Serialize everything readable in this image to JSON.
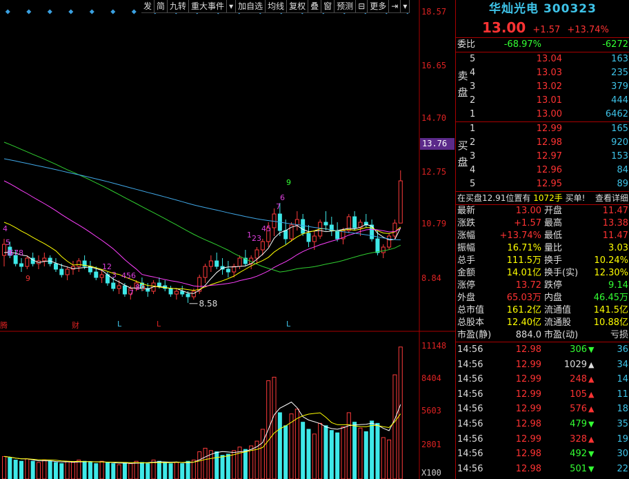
{
  "toolbar": [
    "发",
    "简",
    "九转",
    "重大事件",
    "▾",
    "加自选",
    "均线",
    "复权",
    "叠",
    "窗",
    "预测",
    "⊟",
    "更多",
    "⇥",
    "▾"
  ],
  "price_axis": [
    "18.57",
    "16.65",
    "14.70",
    "13.76",
    "12.75",
    "10.79",
    "8.84"
  ],
  "volume_axis": [
    "11148",
    "8404",
    "5603",
    "2801",
    "X100"
  ],
  "current_price_tag": "13.76",
  "low_marker": "8.58",
  "event_labels": [
    {
      "text": "腾",
      "color": "#dd2222"
    },
    {
      "text": "财",
      "color": "#dd2222"
    },
    {
      "text": "L",
      "color": "#3ec3e8"
    },
    {
      "text": "L",
      "color": "#dd2222"
    },
    {
      "text": "L",
      "color": "#3ec3e8"
    }
  ],
  "td_marks": [
    {
      "text": "9",
      "color": "#3f3"
    },
    {
      "text": "7",
      "color": "#e040e0"
    },
    {
      "text": "6",
      "color": "#e040e0"
    },
    {
      "text": "45",
      "color": "#e040e0"
    },
    {
      "text": "23",
      "color": "#e040e0"
    },
    {
      "text": "1",
      "color": "#e040e0"
    },
    {
      "text": "5",
      "color": "#e040e0"
    },
    {
      "text": "4",
      "color": "#e040e0"
    },
    {
      "text": "678",
      "color": "#e040e0"
    },
    {
      "text": "9",
      "color": "#e33"
    },
    {
      "text": "12",
      "color": "#e040e0"
    },
    {
      "text": "3",
      "color": "#e040e0"
    },
    {
      "text": "456",
      "color": "#e040e0"
    },
    {
      "text": "8",
      "color": "#e040e0"
    },
    {
      "text": "9",
      "color": "#e33"
    },
    {
      "text": "7",
      "color": "#e040e0"
    },
    {
      "text": "8",
      "color": "#e040e0"
    }
  ],
  "stock": {
    "name": "华灿光电",
    "code": "300323",
    "price": "13.00",
    "change": "+1.57",
    "change_pct": "+13.74%"
  },
  "weibi": {
    "label": "委比",
    "pct": "-68.97%",
    "diff": "-6272"
  },
  "sell": {
    "side": [
      "卖",
      "盘"
    ],
    "levels": [
      {
        "lvl": "5",
        "price": "13.04",
        "vol": "163"
      },
      {
        "lvl": "4",
        "price": "13.03",
        "vol": "235"
      },
      {
        "lvl": "3",
        "price": "13.02",
        "vol": "379"
      },
      {
        "lvl": "2",
        "price": "13.01",
        "vol": "444"
      },
      {
        "lvl": "1",
        "price": "13.00",
        "vol": "6462"
      }
    ]
  },
  "buy": {
    "side": [
      "买",
      "盘"
    ],
    "levels": [
      {
        "lvl": "1",
        "price": "12.99",
        "vol": "165"
      },
      {
        "lvl": "2",
        "price": "12.98",
        "vol": "920"
      },
      {
        "lvl": "3",
        "price": "12.97",
        "vol": "153"
      },
      {
        "lvl": "4",
        "price": "12.96",
        "vol": "84"
      },
      {
        "lvl": "5",
        "price": "12.95",
        "vol": "89"
      }
    ]
  },
  "info_line": {
    "a": "在买盘",
    "b": "12.91",
    "c": "位置有",
    "d": "1072手",
    "e": "买单!",
    "link": "查看详细"
  },
  "stats": [
    {
      "l1": "最新",
      "v1": "13.00",
      "c1": "red",
      "l2": "开盘",
      "v2": "11.47",
      "c2": "red"
    },
    {
      "l1": "涨跌",
      "v1": "+1.57",
      "c1": "red",
      "l2": "最高",
      "v2": "13.38",
      "c2": "red"
    },
    {
      "l1": "涨幅",
      "v1": "+13.74%",
      "c1": "red",
      "l2": "最低",
      "v2": "11.47",
      "c2": "red"
    },
    {
      "l1": "振幅",
      "v1": "16.71%",
      "c1": "yellow",
      "l2": "量比",
      "v2": "3.03",
      "c2": "yellow"
    },
    {
      "l1": "总手",
      "v1": "111.5万",
      "c1": "yellow",
      "l2": "换手",
      "v2": "10.24%",
      "c2": "yellow"
    },
    {
      "l1": "金额",
      "v1": "14.01亿",
      "c1": "yellow",
      "l2": "换手(实)",
      "v2": "12.30%",
      "c2": "yellow"
    },
    {
      "l1": "涨停",
      "v1": "13.72",
      "c1": "red",
      "l2": "跌停",
      "v2": "9.14",
      "c2": "green"
    },
    {
      "l1": "外盘",
      "v1": "65.03万",
      "c1": "red",
      "l2": "内盘",
      "v2": "46.45万",
      "c2": "green"
    },
    {
      "l1": "总市值",
      "v1": "161.2亿",
      "c1": "yellow",
      "l2": "流通值",
      "v2": "141.5亿",
      "c2": "yellow"
    },
    {
      "l1": "总股本",
      "v1": "12.40亿",
      "c1": "yellow",
      "l2": "流通股",
      "v2": "10.88亿",
      "c2": "yellow"
    },
    {
      "l1": "市盈(静)",
      "v1": "884.0",
      "c1": "white",
      "l2": "市盈(动)",
      "v2": "亏损",
      "c2": "white"
    }
  ],
  "ticks": [
    {
      "t": "14:56",
      "p": "12.98",
      "v": "306",
      "dir": "down",
      "n": "36"
    },
    {
      "t": "14:56",
      "p": "12.99",
      "v": "1029",
      "dir": "up-white",
      "n": "34"
    },
    {
      "t": "14:56",
      "p": "12.99",
      "v": "248",
      "dir": "up",
      "n": "14"
    },
    {
      "t": "14:56",
      "p": "12.99",
      "v": "105",
      "dir": "up",
      "n": "11"
    },
    {
      "t": "14:56",
      "p": "12.99",
      "v": "576",
      "dir": "up",
      "n": "18"
    },
    {
      "t": "14:56",
      "p": "12.98",
      "v": "479",
      "dir": "down",
      "n": "35"
    },
    {
      "t": "14:56",
      "p": "12.99",
      "v": "328",
      "dir": "up",
      "n": "19"
    },
    {
      "t": "14:56",
      "p": "12.98",
      "v": "492",
      "dir": "down",
      "n": "30"
    },
    {
      "t": "14:56",
      "p": "12.98",
      "v": "501",
      "dir": "down",
      "n": "22"
    }
  ],
  "chart_data": {
    "type": "candlestick",
    "candles": [
      [
        10.3,
        10.9,
        9.9,
        10.7
      ],
      [
        10.6,
        10.8,
        10.2,
        10.3
      ],
      [
        10.3,
        10.5,
        9.9,
        10.0
      ],
      [
        10.0,
        10.2,
        9.7,
        9.9
      ],
      [
        9.9,
        10.3,
        9.8,
        10.2
      ],
      [
        10.2,
        10.4,
        9.9,
        10.0
      ],
      [
        10.0,
        10.3,
        9.8,
        10.1
      ],
      [
        10.1,
        10.4,
        9.9,
        10.2
      ],
      [
        10.2,
        10.3,
        9.9,
        10.0
      ],
      [
        10.0,
        10.2,
        9.7,
        9.8
      ],
      [
        9.8,
        10.0,
        9.5,
        9.6
      ],
      [
        9.6,
        9.9,
        9.4,
        9.8
      ],
      [
        9.8,
        10.1,
        9.6,
        9.9
      ],
      [
        9.9,
        10.2,
        9.7,
        10.1
      ],
      [
        10.1,
        10.3,
        9.8,
        9.9
      ],
      [
        9.9,
        10.1,
        9.6,
        9.7
      ],
      [
        9.7,
        9.9,
        9.4,
        9.5
      ],
      [
        9.5,
        9.8,
        9.3,
        9.6
      ],
      [
        9.6,
        9.7,
        9.2,
        9.3
      ],
      [
        9.3,
        9.5,
        9.0,
        9.1
      ],
      [
        9.1,
        9.4,
        8.9,
        9.2
      ],
      [
        9.2,
        9.3,
        8.8,
        8.9
      ],
      [
        8.9,
        9.2,
        8.7,
        9.1
      ],
      [
        9.1,
        9.4,
        9.0,
        9.3
      ],
      [
        9.3,
        9.5,
        9.0,
        9.1
      ],
      [
        9.1,
        9.3,
        8.8,
        9.0
      ],
      [
        9.0,
        9.4,
        8.9,
        9.3
      ],
      [
        9.3,
        9.5,
        9.1,
        9.2
      ],
      [
        9.2,
        9.4,
        9.0,
        9.1
      ],
      [
        9.1,
        9.2,
        8.8,
        8.9
      ],
      [
        8.9,
        9.1,
        8.7,
        9.0
      ],
      [
        9.0,
        9.2,
        8.8,
        8.9
      ],
      [
        8.9,
        9.0,
        8.58,
        8.8
      ],
      [
        8.8,
        9.1,
        8.7,
        9.0
      ],
      [
        9.0,
        9.6,
        8.9,
        9.5
      ],
      [
        9.5,
        10.0,
        9.3,
        9.9
      ],
      [
        9.9,
        10.3,
        9.7,
        10.1
      ],
      [
        10.1,
        10.4,
        9.8,
        9.9
      ],
      [
        9.9,
        10.2,
        9.6,
        9.8
      ],
      [
        9.8,
        10.1,
        9.5,
        9.7
      ],
      [
        9.7,
        10.0,
        9.5,
        9.9
      ],
      [
        9.9,
        10.3,
        9.8,
        10.2
      ],
      [
        10.2,
        10.5,
        9.9,
        10.0
      ],
      [
        10.0,
        10.3,
        9.8,
        10.2
      ],
      [
        10.2,
        10.6,
        10.0,
        10.5
      ],
      [
        10.5,
        10.9,
        10.3,
        10.8
      ],
      [
        10.8,
        11.5,
        10.6,
        11.3
      ],
      [
        11.3,
        12.0,
        11.0,
        11.8
      ],
      [
        11.8,
        12.2,
        11.0,
        11.2
      ],
      [
        11.2,
        11.6,
        10.7,
        10.9
      ],
      [
        10.9,
        11.5,
        10.8,
        11.4
      ],
      [
        11.4,
        11.9,
        11.2,
        11.6
      ],
      [
        11.6,
        11.8,
        11.0,
        11.1
      ],
      [
        11.1,
        11.4,
        10.6,
        10.8
      ],
      [
        10.8,
        11.2,
        10.5,
        11.0
      ],
      [
        11.0,
        11.6,
        10.9,
        11.5
      ],
      [
        11.5,
        11.9,
        11.2,
        11.4
      ],
      [
        11.4,
        11.7,
        11.0,
        11.2
      ],
      [
        11.2,
        11.5,
        10.8,
        10.9
      ],
      [
        10.9,
        11.3,
        10.7,
        11.2
      ],
      [
        11.2,
        11.8,
        11.1,
        11.7
      ],
      [
        11.7,
        11.9,
        11.2,
        11.3
      ],
      [
        11.3,
        11.6,
        11.0,
        11.5
      ],
      [
        11.5,
        11.8,
        11.3,
        11.4
      ],
      [
        11.4,
        11.6,
        10.8,
        10.9
      ],
      [
        10.9,
        11.2,
        10.3,
        10.4
      ],
      [
        10.4,
        10.7,
        10.2,
        10.6
      ],
      [
        10.6,
        11.1,
        10.5,
        11.0
      ],
      [
        11.0,
        11.6,
        10.9,
        11.47
      ],
      [
        11.47,
        13.38,
        11.47,
        13.0
      ]
    ],
    "volumes": [
      1900,
      1800,
      1600,
      1500,
      1700,
      1500,
      1400,
      1600,
      1500,
      1400,
      1300,
      1500,
      1400,
      1600,
      1500,
      1400,
      1300,
      1500,
      1400,
      1300,
      1200,
      1400,
      1300,
      1500,
      1400,
      1300,
      1600,
      1500,
      1400,
      1300,
      1400,
      1300,
      1500,
      1600,
      2300,
      2600,
      2400,
      2300,
      2000,
      2100,
      2400,
      2700,
      2500,
      2800,
      3200,
      4200,
      8300,
      8600,
      5600,
      4500,
      5500,
      5900,
      4800,
      4200,
      3800,
      4700,
      4500,
      4100,
      3900,
      4400,
      5600,
      4800,
      4300,
      4000,
      4900,
      4700,
      3500,
      3300,
      8800,
      11148
    ],
    "ylim": [
      7.8,
      19.3
    ],
    "volume_ylim": [
      0,
      11600
    ]
  }
}
